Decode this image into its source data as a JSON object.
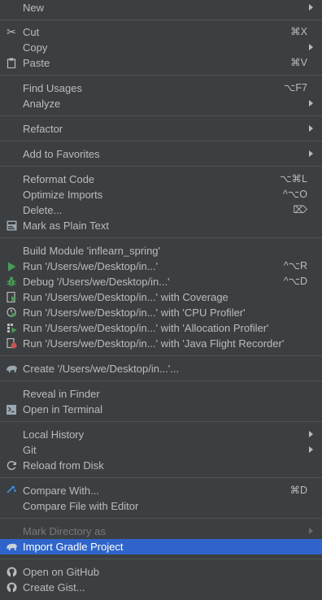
{
  "menu": {
    "new": {
      "label": "New"
    },
    "cut": {
      "label": "Cut",
      "shortcut": "⌘X"
    },
    "copy": {
      "label": "Copy"
    },
    "paste": {
      "label": "Paste",
      "shortcut": "⌘V"
    },
    "find_usages": {
      "label": "Find Usages",
      "shortcut": "⌥F7"
    },
    "analyze": {
      "label": "Analyze"
    },
    "refactor": {
      "label": "Refactor"
    },
    "add_to_favorites": {
      "label": "Add to Favorites"
    },
    "reformat_code": {
      "label": "Reformat Code",
      "shortcut": "⌥⌘L"
    },
    "optimize_imports": {
      "label": "Optimize Imports",
      "shortcut": "^⌥O"
    },
    "delete": {
      "label": "Delete...",
      "shortcut": "⌦"
    },
    "mark_plain_text": {
      "label": "Mark as Plain Text"
    },
    "build_module": {
      "label": "Build Module 'inflearn_spring'"
    },
    "run": {
      "label": "Run '/Users/we/Desktop/in...'",
      "shortcut": "^⌥R"
    },
    "debug": {
      "label": "Debug '/Users/we/Desktop/in...'",
      "shortcut": "^⌥D"
    },
    "run_coverage": {
      "label": "Run '/Users/we/Desktop/in...' with Coverage"
    },
    "run_cpu": {
      "label": "Run '/Users/we/Desktop/in...' with 'CPU Profiler'"
    },
    "run_alloc": {
      "label": "Run '/Users/we/Desktop/in...' with 'Allocation Profiler'"
    },
    "run_jfr": {
      "label": "Run '/Users/we/Desktop/in...' with 'Java Flight Recorder'"
    },
    "create": {
      "label": "Create '/Users/we/Desktop/in...'..."
    },
    "reveal_finder": {
      "label": "Reveal in Finder"
    },
    "open_terminal": {
      "label": "Open in Terminal"
    },
    "local_history": {
      "label": "Local History"
    },
    "git": {
      "label": "Git"
    },
    "reload_disk": {
      "label": "Reload from Disk"
    },
    "compare_with": {
      "label": "Compare With...",
      "shortcut": "⌘D"
    },
    "compare_file_editor": {
      "label": "Compare File with Editor"
    },
    "mark_directory_as": {
      "label": "Mark Directory as"
    },
    "import_gradle": {
      "label": "Import Gradle Project"
    },
    "open_github": {
      "label": "Open on GitHub"
    },
    "create_gist": {
      "label": "Create Gist..."
    }
  },
  "colors": {
    "background": "#3c3f41",
    "text": "#bbbbbb",
    "selected": "#2f65ca",
    "separator": "#515151",
    "run_green": "#499c54",
    "profiler_red": "#c75450"
  }
}
